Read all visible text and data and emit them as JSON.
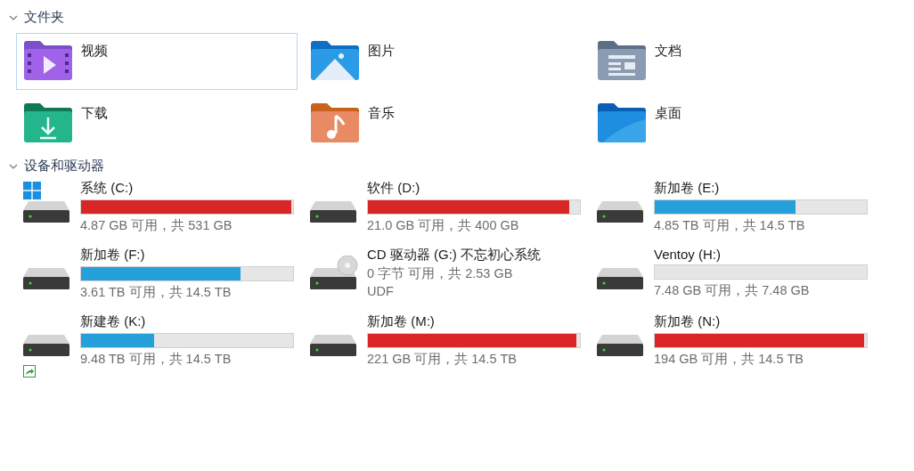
{
  "sections": [
    {
      "kind": "folders",
      "title": "文件夹",
      "expanded": true,
      "items": [
        {
          "kind": "video",
          "label": "视频",
          "selected": true
        },
        {
          "kind": "picture",
          "label": "图片",
          "selected": false
        },
        {
          "kind": "document",
          "label": "文档",
          "selected": false
        },
        {
          "kind": "download",
          "label": "下载",
          "selected": false
        },
        {
          "kind": "music",
          "label": "音乐",
          "selected": false
        },
        {
          "kind": "desktop",
          "label": "桌面",
          "selected": false
        }
      ]
    },
    {
      "kind": "drives",
      "title": "设备和驱动器",
      "expanded": true,
      "items": [
        {
          "kind": "disk",
          "label": "系统 (C:)",
          "level": 0.99,
          "low_space": true,
          "windows_badge": true,
          "space": "4.87 GB 可用，共 531 GB"
        },
        {
          "kind": "disk",
          "label": "软件 (D:)",
          "level": 0.95,
          "low_space": true,
          "space": "21.0 GB 可用，共 400 GB"
        },
        {
          "kind": "disk",
          "label": "新加卷 (E:)",
          "level": 0.665,
          "low_space": false,
          "space": "4.85 TB 可用，共 14.5 TB"
        },
        {
          "kind": "disk",
          "label": "新加卷 (F:)",
          "level": 0.75,
          "low_space": false,
          "space": "3.61 TB 可用，共 14.5 TB"
        },
        {
          "kind": "cd",
          "label": "CD 驱动器 (G:) 不忘初心系统",
          "space": "0 字节 可用，共 2.53 GB",
          "filesystem": "UDF"
        },
        {
          "kind": "disk",
          "label": "Ventoy (H:)",
          "level": 0,
          "space": "7.48 GB 可用，共 7.48 GB"
        },
        {
          "kind": "disk",
          "label": "新建卷 (K:)",
          "level": 0.346,
          "low_space": false,
          "shortcut_badge": true,
          "space": "9.48 TB 可用，共 14.5 TB"
        },
        {
          "kind": "disk",
          "label": "新加卷 (M:)",
          "level": 0.985,
          "low_space": true,
          "space": "221 GB 可用，共 14.5 TB"
        },
        {
          "kind": "disk",
          "label": "新加卷 (N:)",
          "level": 0.987,
          "low_space": true,
          "space": "194 GB 可用，共 14.5 TB"
        }
      ]
    }
  ]
}
